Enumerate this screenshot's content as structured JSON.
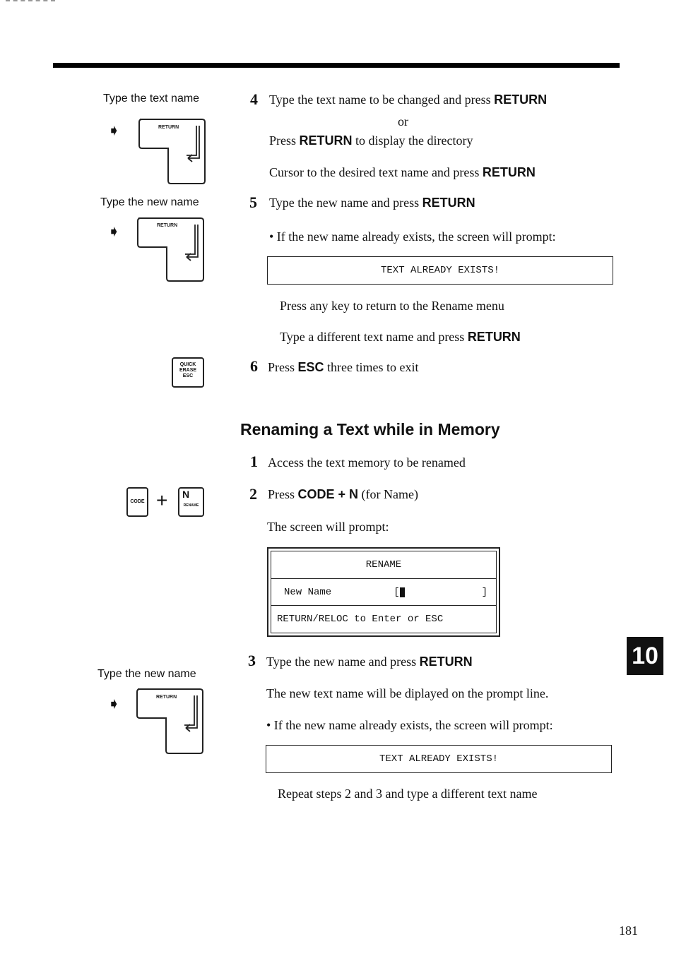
{
  "page": {
    "number": "181",
    "chapter_tab": "10"
  },
  "left_column": {
    "label_type_text_name": "Type the text name",
    "label_type_new_name_1": "Type the new name",
    "label_type_new_name_2": "Type the new name",
    "return_key_label": "RETURN",
    "esc_key_lines": [
      "QUICK",
      "ERASE",
      "ESC"
    ],
    "code_key_label": "CODE",
    "plus": "+",
    "n_key_label": "N",
    "n_key_sublabel": "RENAME"
  },
  "section1": {
    "step4": {
      "num": "4",
      "text": "Type the text name to be changed and press ",
      "key": "RETURN",
      "or": "or",
      "alt_prefix": "Press ",
      "alt_key": "RETURN",
      "alt_suffix": " to display the directory",
      "cursor_text": "Cursor to the desired text name and press ",
      "cursor_key": "RETURN"
    },
    "step5": {
      "num": "5",
      "text": "Type the new name and press ",
      "key": "RETURN",
      "bullet": "• If the new name already exists, the screen will prompt:",
      "prompt": "TEXT ALREADY EXISTS!",
      "after1": "Press any key to return to the Rename menu",
      "after2_text": "Type a different text name and press ",
      "after2_key": "RETURN"
    },
    "step6": {
      "num": "6",
      "prefix": "Press ",
      "key": "ESC",
      "suffix": " three times to exit"
    }
  },
  "section2": {
    "heading": "Renaming a Text while in Memory",
    "step1": {
      "num": "1",
      "text": "Access the text memory to be renamed"
    },
    "step2": {
      "num": "2",
      "prefix": "Press ",
      "key": "CODE + N",
      "suffix": " (for Name)",
      "screen_prompt": "The screen will prompt:"
    },
    "rename_screen": {
      "title": "RENAME",
      "field_label": "New Name",
      "field_open": "[",
      "field_close": "]",
      "footer": "RETURN/RELOC to Enter or ESC"
    },
    "step3": {
      "num": "3",
      "text": "Type the new name and press ",
      "key": "RETURN",
      "note": "The new text name will be diplayed on the prompt line.",
      "bullet": "• If the new name already exists, the screen will prompt:",
      "prompt": "TEXT ALREADY EXISTS!",
      "repeat": "Repeat steps 2 and 3 and type a different text name"
    }
  }
}
